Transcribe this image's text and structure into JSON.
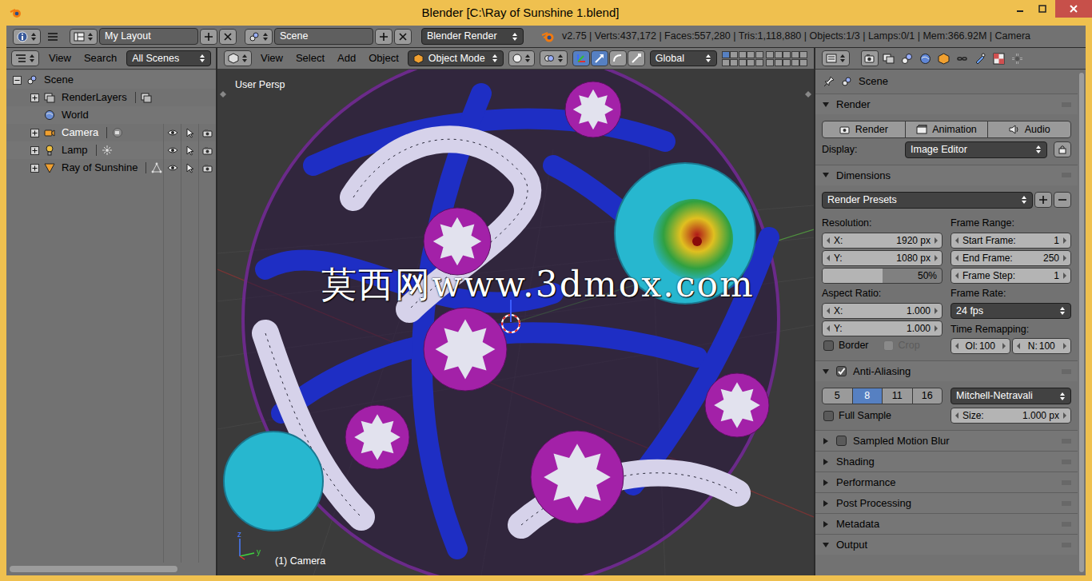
{
  "window": {
    "title": "Blender [C:\\Ray of Sunshine 1.blend]"
  },
  "info_header": {
    "layout": "My Layout",
    "scene": "Scene",
    "engine": "Blender Render",
    "stats": "v2.75 | Verts:437,172 | Faces:557,280 | Tris:1,118,880 | Objects:1/3 | Lamps:0/1 | Mem:366.92M | Camera"
  },
  "outliner": {
    "menus": [
      "View",
      "Search"
    ],
    "filter": "All Scenes",
    "tree": [
      {
        "label": "Scene",
        "kind": "scene",
        "expanded": true,
        "selected": false,
        "children": [
          {
            "label": "RenderLayers",
            "kind": "renderlayers",
            "expanded": false,
            "selected": false,
            "data_kind": "renderlayer"
          },
          {
            "label": "World",
            "kind": "world",
            "selected": false
          },
          {
            "label": "Camera",
            "kind": "camera",
            "expanded": false,
            "selected": true,
            "data_kind": "camera_data",
            "visible": true,
            "selectable": true,
            "renderable": true
          },
          {
            "label": "Lamp",
            "kind": "lamp",
            "expanded": false,
            "selected": false,
            "data_kind": "lamp_data",
            "visible": true,
            "selectable": true,
            "renderable": true
          },
          {
            "label": "Ray of Sunshine",
            "kind": "mesh",
            "expanded": false,
            "selected": false,
            "data_kind": "mesh_data",
            "visible": true,
            "selectable": true,
            "renderable": true
          }
        ]
      }
    ]
  },
  "viewport": {
    "menus": [
      "View",
      "Select",
      "Add",
      "Object"
    ],
    "mode": "Object Mode",
    "manipulator_on": true,
    "manipulators": [
      {
        "kind": "translate",
        "selected": true
      },
      {
        "kind": "rotate",
        "selected": false
      },
      {
        "kind": "scale",
        "selected": false
      }
    ],
    "orientation": "Global",
    "layers": [
      true,
      false,
      false,
      false,
      false,
      false,
      false,
      false,
      false,
      false,
      false,
      false,
      false,
      false,
      false,
      false,
      false,
      false,
      false,
      false
    ],
    "view_label": "User Persp",
    "object_label": "(1) Camera",
    "watermark": "莫西网www.3dmox.com",
    "gizmo_axes": [
      {
        "label": "z",
        "color": "#4a7cff"
      },
      {
        "label": "y",
        "color": "#3fd43f"
      }
    ]
  },
  "properties": {
    "tabs": [
      {
        "kind": "render",
        "selected": true
      },
      {
        "kind": "render_layers",
        "selected": false
      },
      {
        "kind": "scene",
        "selected": false
      },
      {
        "kind": "world",
        "selected": false
      },
      {
        "kind": "object",
        "selected": false
      },
      {
        "kind": "constraints",
        "selected": false
      },
      {
        "kind": "modifiers",
        "selected": false
      },
      {
        "kind": "texture",
        "selected": false
      },
      {
        "kind": "physics",
        "selected": false
      }
    ],
    "path": "Scene",
    "render": {
      "title": "Render",
      "expanded": true,
      "buttons": [
        "Render",
        "Animation",
        "Audio"
      ],
      "display_label": "Display:",
      "display_value": "Image Editor"
    },
    "dimensions": {
      "title": "Dimensions",
      "expanded": true,
      "presets": "Render Presets",
      "resolution_label": "Resolution:",
      "resolution": [
        {
          "label": "X:",
          "value": "1920 px"
        },
        {
          "label": "Y:",
          "value": "1080 px"
        }
      ],
      "percentage": {
        "value": "50%",
        "level": 0.5
      },
      "aspect_label": "Aspect Ratio:",
      "aspect": [
        {
          "label": "X:",
          "value": "1.000"
        },
        {
          "label": "Y:",
          "value": "1.000"
        }
      ],
      "border": {
        "label": "Border",
        "checked": false,
        "disabled": false
      },
      "crop": {
        "label": "Crop",
        "checked": false,
        "disabled": true
      },
      "frame_range_label": "Frame Range:",
      "frame_range": [
        {
          "label": "Start Frame:",
          "value": "1"
        },
        {
          "label": "End Frame:",
          "value": "250"
        },
        {
          "label": "Frame Step:",
          "value": "1"
        }
      ],
      "frame_rate_label": "Frame Rate:",
      "frame_rate": "24 fps",
      "time_label": "Time Remapping:",
      "time": [
        {
          "label": "Ol:",
          "value": "100"
        },
        {
          "label": "N:",
          "value": "100"
        }
      ]
    },
    "anti_aliasing": {
      "title": "Anti-Aliasing",
      "expanded": true,
      "checked": true,
      "samples": [
        {
          "label": "5",
          "selected": false
        },
        {
          "label": "8",
          "selected": true
        },
        {
          "label": "11",
          "selected": false
        },
        {
          "label": "16",
          "selected": false
        }
      ],
      "filter": "Mitchell-Netravali",
      "full_sample": {
        "label": "Full Sample",
        "checked": false
      },
      "size": {
        "label": "Size:",
        "value": "1.000 px"
      }
    },
    "collapsed": [
      {
        "title": "Sampled Motion Blur",
        "expanded": false,
        "kind": "checkbox",
        "checked": false
      },
      {
        "title": "Shading",
        "expanded": false,
        "kind": "plain"
      },
      {
        "title": "Performance",
        "expanded": false,
        "kind": "plain"
      },
      {
        "title": "Post Processing",
        "expanded": false,
        "kind": "plain"
      },
      {
        "title": "Metadata",
        "expanded": false,
        "kind": "plain"
      },
      {
        "title": "Output",
        "expanded": true,
        "kind": "plain"
      }
    ]
  }
}
